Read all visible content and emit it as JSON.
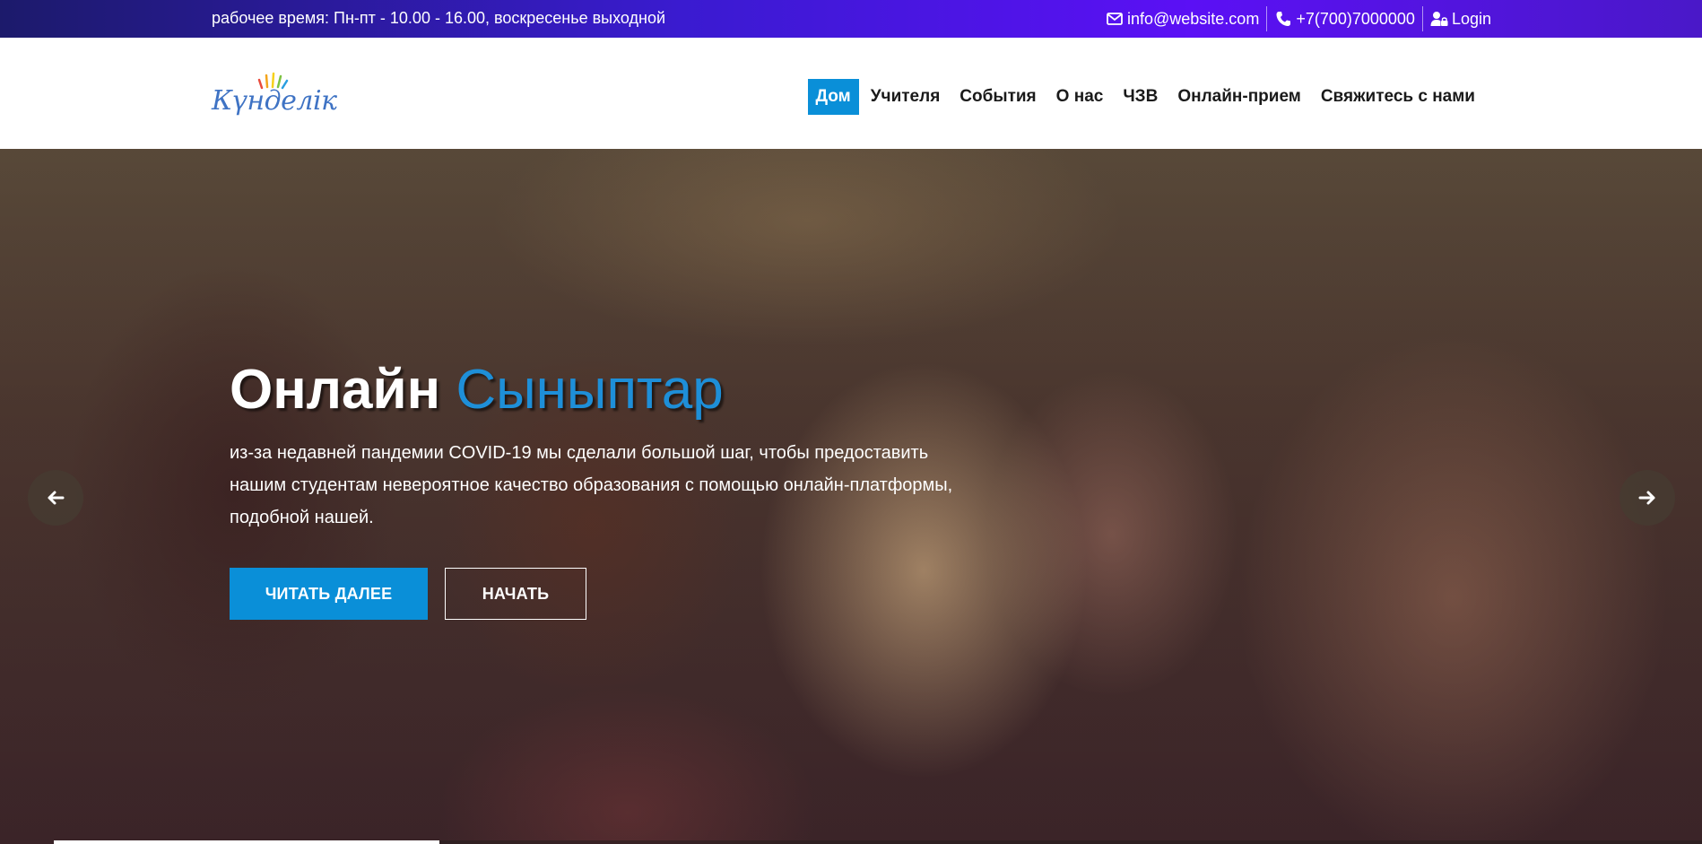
{
  "topbar": {
    "hours_label": "рабочее время: Пн-пт - 10.00 - 16.00, воскресенье выходной",
    "email": "info@website.com",
    "phone": "+7(700)7000000",
    "login": "Login",
    "icons": [
      "envelope-icon",
      "phone-icon",
      "user-lock-icon"
    ]
  },
  "header": {
    "logo_text": "Күнделік",
    "nav": [
      {
        "label": "Дом",
        "active": true
      },
      {
        "label": "Учителя"
      },
      {
        "label": "События"
      },
      {
        "label": "О нас"
      },
      {
        "label": "ЧЗВ"
      },
      {
        "label": "Онлайн-прием"
      },
      {
        "label": "Свяжитесь с нами"
      }
    ]
  },
  "hero": {
    "title_part1": "Онлайн",
    "title_part2": "Сыныптар",
    "text": "из-за недавней пандемии COVID-19 мы сделали большой шаг, чтобы предоставить нашим студентам невероятное качество образования с помощью онлайн-платформы, подобной нашей.",
    "primary_button": "ЧИТАТЬ ДАЛЕЕ",
    "secondary_button": "НАЧАТЬ",
    "icons": [
      "arrow-left-icon",
      "arrow-right-icon"
    ]
  },
  "colors": {
    "accent": "#0a8fd8",
    "topbar_start": "#1c1a6b",
    "topbar_end": "#5b10f5",
    "title_highlight": "#1e8fd8"
  }
}
